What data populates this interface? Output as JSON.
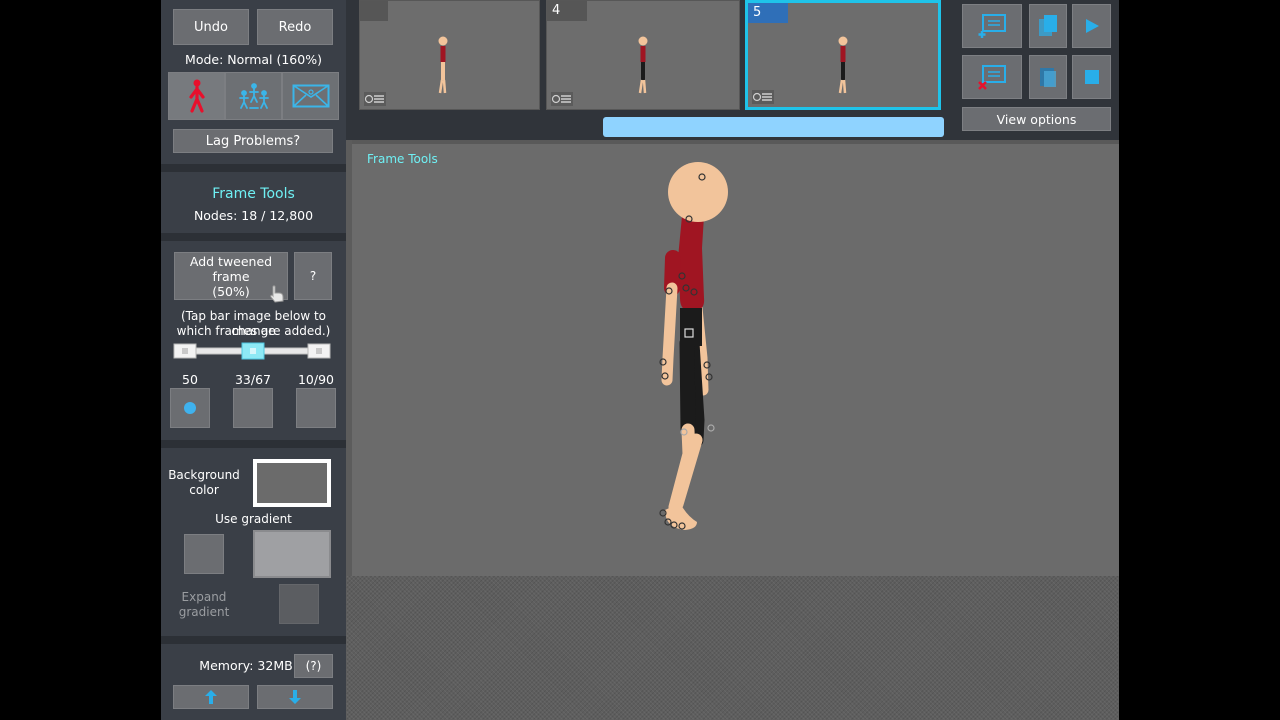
{
  "toolbar": {
    "undo_label": "Undo",
    "redo_label": "Redo"
  },
  "mode_text": "Mode: Normal (160%)",
  "lag_button": "Lag Problems?",
  "frame_tools": {
    "title": "Frame Tools",
    "nodes": "Nodes: 18 / 12,800"
  },
  "tween": {
    "add_label_line1": "Add tweened frame",
    "add_label_line2": "(50%)",
    "help_label": "?",
    "hint_line1": "(Tap bar image below to change",
    "hint_line2": "which frames are added.)",
    "options": [
      {
        "label": "50",
        "selected": true
      },
      {
        "label": "33/67",
        "selected": false
      },
      {
        "label": "10/90",
        "selected": false
      }
    ]
  },
  "background": {
    "color_label_line1": "Background",
    "color_label_line2": "color",
    "gradient_label": "Use gradient",
    "expand_line1": "Expand",
    "expand_line2": "gradient",
    "color_hex": "#6b6b6b"
  },
  "memory": {
    "label": "Memory: 32MB",
    "help_label": "(?)"
  },
  "timeline": {
    "frames": [
      {
        "number": "",
        "selected": false
      },
      {
        "number": "4",
        "selected": false
      },
      {
        "number": "5",
        "selected": true
      }
    ]
  },
  "view_options_label": "View options",
  "canvas_label": "Frame Tools",
  "colors": {
    "accent": "#1fc3e9",
    "figure_shirt": "#a01522",
    "figure_pants": "#1b1b1b",
    "skin": "#f2c49b"
  },
  "icons": {
    "toolbar": [
      "add-frame-icon",
      "copy-frame-icon",
      "play-icon",
      "delete-frame-icon",
      "paste-frame-icon",
      "stop-icon"
    ],
    "mode": [
      "single-figure-icon",
      "multi-figure-icon",
      "image-icon"
    ],
    "memory": [
      "arrow-up-icon",
      "arrow-down-icon"
    ]
  }
}
